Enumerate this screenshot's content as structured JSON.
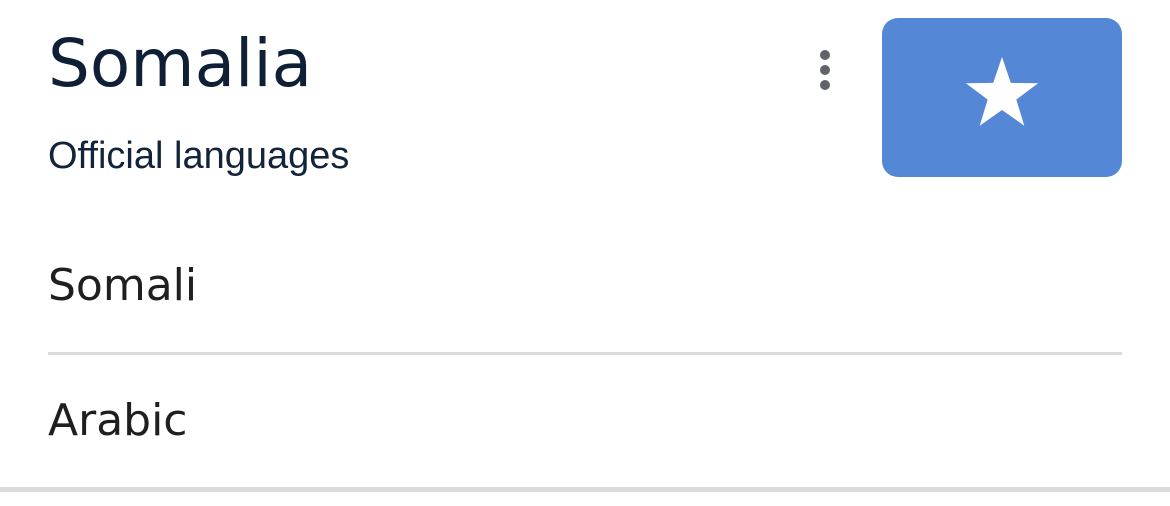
{
  "header": {
    "title": "Somalia",
    "subtitle": "Official languages"
  },
  "icons": {
    "more": "more-vert-icon",
    "flag_star": "star-icon"
  },
  "flag": {
    "background_color": "#5587d7",
    "star_color": "#ffffff"
  },
  "languages": [
    {
      "label": "Somali"
    },
    {
      "label": "Arabic"
    }
  ]
}
